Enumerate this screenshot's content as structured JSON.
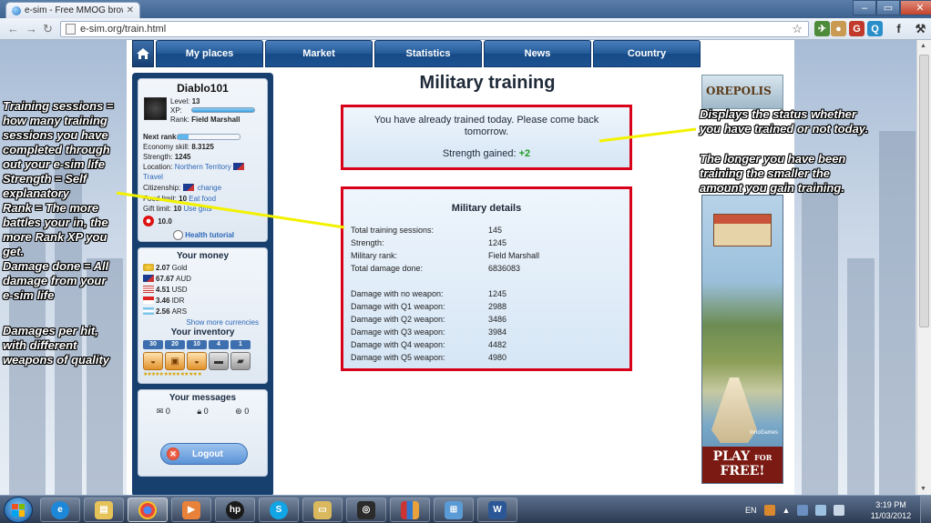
{
  "browser": {
    "tab_title": "e-sim - Free MMOG browse",
    "url": "e-sim.org/train.html"
  },
  "menu": {
    "items": [
      "My places",
      "Market",
      "Statistics",
      "News",
      "Country"
    ]
  },
  "profile": {
    "name": "Diablo101",
    "level_label": "Level:",
    "level": "13",
    "xp_label": "XP:",
    "rank_label": "Rank:",
    "rank": "Field Marshall",
    "next_rank_label": "Next rank:",
    "next_rank_progress": 0.18,
    "economy_label": "Economy skill:",
    "economy": "8.3125",
    "strength_label": "Strength:",
    "strength": "1245",
    "location_label": "Location:",
    "location": "Northern Territory",
    "travel": "Travel",
    "citizenship_label": "Citizenship:",
    "citizenship_change": "change",
    "food_label": "Food limit:",
    "food_value": "10",
    "food_link": "Eat food",
    "gift_label": "Gift limit:",
    "gift_value": "10",
    "gift_link": "Use gifts",
    "health": "10.0",
    "health_tutorial": "Health tutorial"
  },
  "money": {
    "title": "Your money",
    "rows": [
      {
        "amount": "2.07",
        "currency": "Gold",
        "flag": "gold"
      },
      {
        "amount": "67.67",
        "currency": "AUD",
        "flag": "au"
      },
      {
        "amount": "4.51",
        "currency": "USD",
        "flag": "us"
      },
      {
        "amount": "3.46",
        "currency": "IDR",
        "flag": "id"
      },
      {
        "amount": "2.56",
        "currency": "ARS",
        "flag": "ar"
      }
    ],
    "show_more": "Show more currencies"
  },
  "inventory": {
    "title": "Your inventory",
    "counts": [
      "30",
      "20",
      "10",
      "4",
      "1"
    ]
  },
  "messages": {
    "title": "Your messages",
    "counts": [
      "0",
      "0",
      "0"
    ]
  },
  "logout_label": "Logout",
  "main": {
    "title": "Military training",
    "status_message": "You have already trained today. Please come back tomorrow.",
    "strength_gained_label": "Strength gained:",
    "strength_gained_value": "+2",
    "details_title": "Military details",
    "details": [
      {
        "label": "Total training sessions:",
        "value": "145"
      },
      {
        "label": "Strength:",
        "value": "1245"
      },
      {
        "label": "Military rank:",
        "value": "Field Marshall"
      },
      {
        "label": "Total damage done:",
        "value": "6836083"
      }
    ],
    "damage": [
      {
        "label": "Damage with no weapon:",
        "value": "1245"
      },
      {
        "label": "Damage with Q1 weapon:",
        "value": "2988"
      },
      {
        "label": "Damage with Q2 weapon:",
        "value": "3486"
      },
      {
        "label": "Damage with Q3 weapon:",
        "value": "3984"
      },
      {
        "label": "Damage with Q4 weapon:",
        "value": "4482"
      },
      {
        "label": "Damage with Q5 weapon:",
        "value": "4980"
      }
    ]
  },
  "ads": {
    "top_text": "OREPOLIS",
    "brand": "InnoGames",
    "play_1": "PLAY",
    "play_for": "FOR",
    "play_2": "FREE!"
  },
  "annotations": {
    "left_1": "Training sessions =\nhow many training\nsessions you have\ncompleted through\nout your e-sim life\nStrength = Self\nexplanatory\nRank = The more\nbattles your in, the\nmore Rank XP you\nget.\nDamage done = All\ndamage from your\ne-sim life",
    "left_2": "Damages per hit,\nwith different\nweapons of quality",
    "right_1": "Displays the status whether\nyou have trained or not today.",
    "right_2": "The longer you have been\ntraining the smaller the\namount you gain training."
  },
  "taskbar": {
    "language": "EN",
    "time": "3:19 PM",
    "date": "11/03/2012"
  },
  "colors": {
    "highlight_border": "#d9001a",
    "annotation_line": "#f2f200",
    "gain_green": "#1c9e22"
  }
}
